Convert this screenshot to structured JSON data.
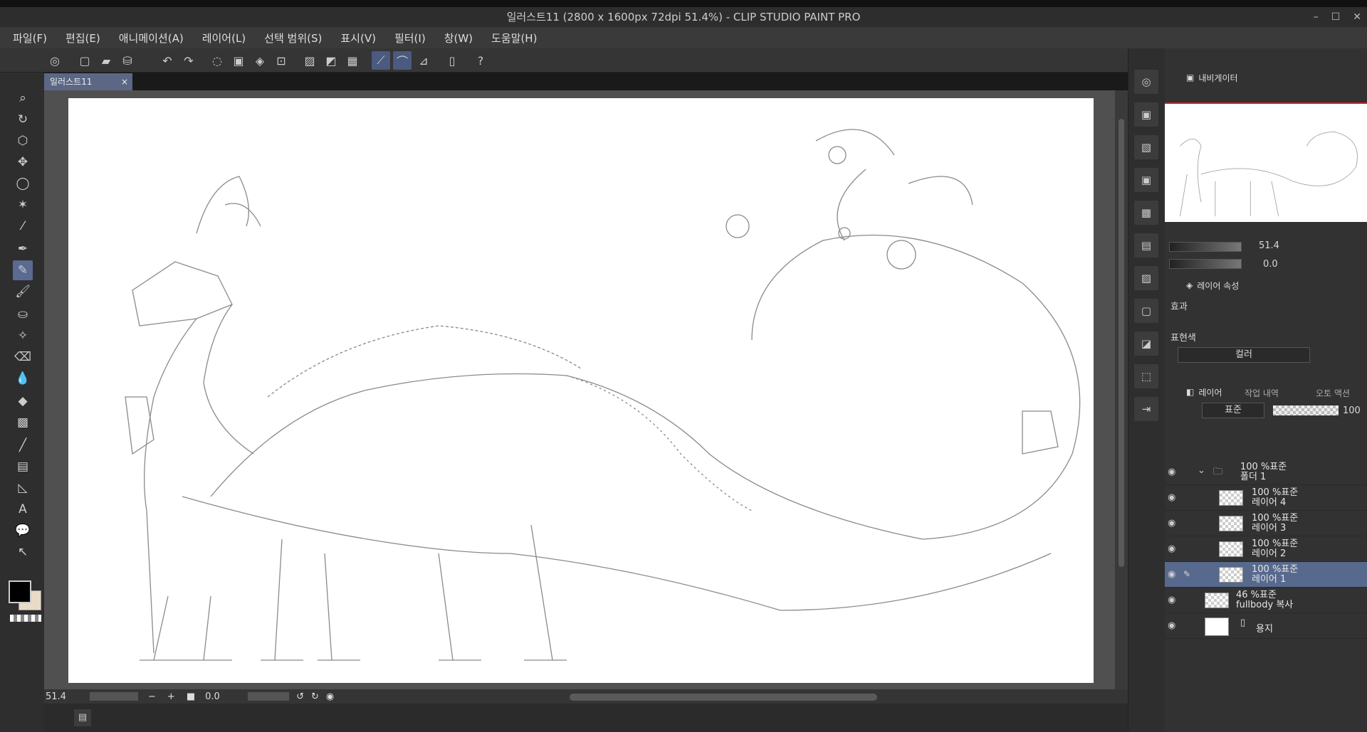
{
  "window": {
    "title": "일러스트11 (2800 x 1600px 72dpi 51.4%)  - CLIP STUDIO PAINT PRO",
    "controls": [
      "–",
      "☐",
      "✕"
    ]
  },
  "menu": [
    "파일(F)",
    "편집(E)",
    "애니메이션(A)",
    "레이어(L)",
    "선택 범위(S)",
    "표시(V)",
    "필터(I)",
    "창(W)",
    "도움말(H)"
  ],
  "document_tab": {
    "label": "일러스트11",
    "close": "×"
  },
  "status": {
    "zoom": "51.4",
    "rotation": "0.0"
  },
  "panels": {
    "navigator_tab": "내비게이터",
    "navigator_zoom": "51.4",
    "navigator_rotation": "0.0",
    "layer_property_tab": "레이어 속성",
    "effect_label": "효과",
    "expression_color_label": "표현색",
    "expression_color_value": "컬러",
    "layer_tab": "레이어",
    "history_tab": "작업 내역",
    "auto_action_tab": "오토 액션",
    "blend_mode": "표준",
    "opacity": "100"
  },
  "layers": [
    {
      "mode": "100 %표준",
      "name": "폴더 1",
      "type": "folder",
      "selected": false
    },
    {
      "mode": "100 %표준",
      "name": "레이어 4",
      "type": "raster",
      "selected": false
    },
    {
      "mode": "100 %표준",
      "name": "레이어 3",
      "type": "raster",
      "selected": false
    },
    {
      "mode": "100 %표준",
      "name": "레이어 2",
      "type": "raster",
      "selected": false
    },
    {
      "mode": "100 %표준",
      "name": "레이어 1",
      "type": "raster",
      "selected": true
    },
    {
      "mode": "46 %표준",
      "name": "fullbody 복사",
      "type": "raster",
      "selected": false
    },
    {
      "mode": "",
      "name": "용지",
      "type": "paper",
      "selected": false
    }
  ],
  "colors": {
    "accent": "#58698e",
    "foreground": "#000000",
    "background": "#e8dcc8"
  }
}
